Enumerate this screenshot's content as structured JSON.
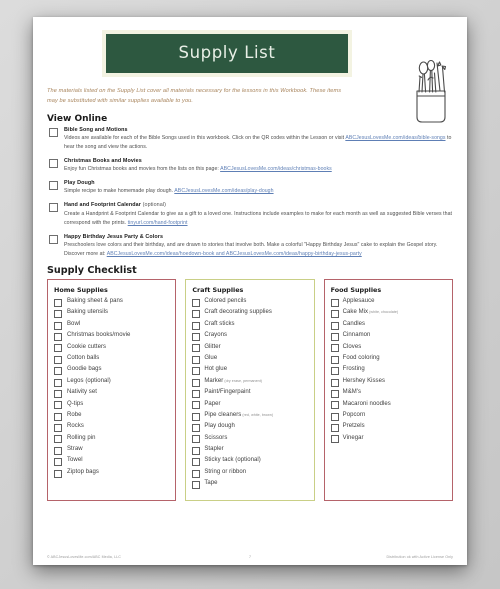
{
  "document": {
    "title": "Supply List",
    "intro": "The materials listed on the Supply List cover all materials necessary for the lessons in this Workbook.  These items may be substituted with similar supplies available to you."
  },
  "view_online": {
    "heading": "View Online",
    "items": [
      {
        "title": "Bible Song and Motions",
        "body_before": "Videos are available for each of the Bible Songs used in this workbook.  Click on the QR codes within the Lesson  or visit ",
        "link": "ABCJesusLovesMe.com/ideas/bible-songs",
        "body_after": " to hear the song and view the actions."
      },
      {
        "title": "Christmas Books and Movies",
        "body_before": "Enjoy fun Christmas books and movies from the lists on this page:  ",
        "link": "ABCJesusLovesMe.com/ideas/christmas-books",
        "body_after": ""
      },
      {
        "title": "Play Dough",
        "body_before": "Simple recipe to make homemade play dough.  ",
        "link": "ABCJesusLovesMe.com/ideas/play-dough",
        "body_after": ""
      },
      {
        "title": "Hand and Footprint Calendar",
        "title_optional": " (optional)",
        "body_before": "Create a Handprint & Footprint Calendar to give as a gift to a loved one. Instructions include examples to make for each month as well as suggested Bible verses that correspond with the prints.  ",
        "link": "tinyurl.com/hand-footprint",
        "body_after": ""
      },
      {
        "title": "Happy Birthday Jesus Party &  Colors",
        "body_before": "Preschoolers love colors and their birthday, and are drawn to stories that involve both. Make a colorful \"Happy Birthday Jesus\" cake to explain the Gospel story.  Discover more at:  ",
        "link": "ABCJesusLovesMe.com/ideas/hoedown-book and ABCJesusLovesMe.com/ideas/happy-birthday-jesus-party",
        "body_after": ""
      }
    ]
  },
  "checklist": {
    "heading": "Supply Checklist",
    "columns": [
      {
        "title": "Home Supplies",
        "accent": "#b5636a",
        "items": [
          {
            "label": "Baking sheet & pans"
          },
          {
            "label": "Baking utensils"
          },
          {
            "label": "Bowl"
          },
          {
            "label": "Christmas books/movie"
          },
          {
            "label": "Cookie cutters"
          },
          {
            "label": "Cotton balls"
          },
          {
            "label": "Goodie bags"
          },
          {
            "label": "Legos (optional)"
          },
          {
            "label": "Nativity set"
          },
          {
            "label": "Q-tips"
          },
          {
            "label": "Robe"
          },
          {
            "label": "Rocks"
          },
          {
            "label": "Rolling pin"
          },
          {
            "label": "Straw"
          },
          {
            "label": "Towel"
          },
          {
            "label": "Ziptop bags"
          }
        ]
      },
      {
        "title": "Craft Supplies",
        "accent": "#c9cf86",
        "items": [
          {
            "label": "Colored pencils"
          },
          {
            "label": "Craft decorating supplies"
          },
          {
            "label": "Craft sticks"
          },
          {
            "label": "Crayons"
          },
          {
            "label": "Glitter"
          },
          {
            "label": "Glue"
          },
          {
            "label": "Hot glue"
          },
          {
            "label": "Marker",
            "note": " (dry erase, permanent)"
          },
          {
            "label": "Paint/Fingerpaint"
          },
          {
            "label": "Paper"
          },
          {
            "label": "Pipe cleaners",
            "note": " (red, white, brown)"
          },
          {
            "label": "Play dough"
          },
          {
            "label": "Scissors"
          },
          {
            "label": "Stapler"
          },
          {
            "label": "Sticky tack (optional)"
          },
          {
            "label": "String or ribbon"
          },
          {
            "label": "Tape"
          }
        ]
      },
      {
        "title": "Food Supplies",
        "accent": "#b5636a",
        "items": [
          {
            "label": "Applesauce"
          },
          {
            "label": "Cake Mix",
            "note": " (white, chocolate)"
          },
          {
            "label": "Candles"
          },
          {
            "label": "Cinnamon"
          },
          {
            "label": "Cloves"
          },
          {
            "label": "Food coloring"
          },
          {
            "label": "Frosting"
          },
          {
            "label": "Hershey Kisses"
          },
          {
            "label": "M&M's"
          },
          {
            "label": "Macaroni noodles"
          },
          {
            "label": "Popcorn"
          },
          {
            "label": "Pretzels"
          },
          {
            "label": "Vinegar"
          }
        ]
      }
    ]
  },
  "footer": {
    "left": "© ABCJesusLovesMe.com/ABC Media, LLC",
    "page": "7",
    "right": "Distribution ok with Active License Only"
  },
  "colors": {
    "banner_green": "#2d5840",
    "banner_frame": "#f3f3e2",
    "red_border": "#b5636a",
    "green_border": "#c9cf86",
    "link_blue": "#5e7fb5",
    "intro_tan": "#a8845c"
  }
}
